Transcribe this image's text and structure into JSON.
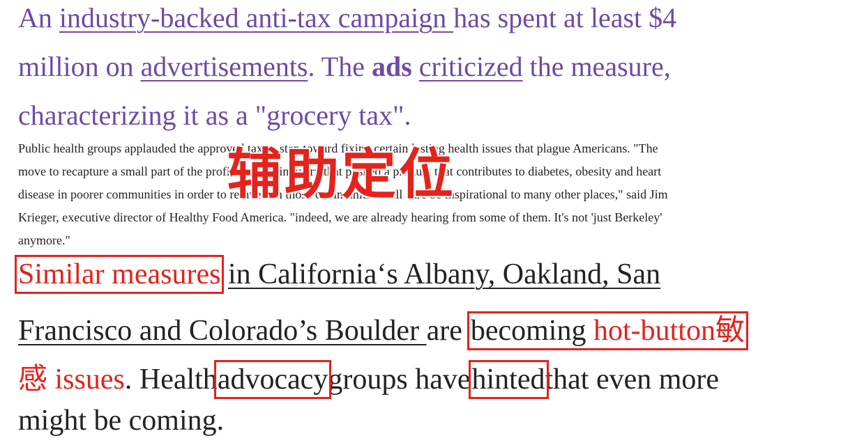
{
  "purple_para": {
    "l1_a": "An ",
    "l1_link": "industry-backed anti-tax campaign ",
    "l1_b": "has spent at least $4",
    "l2_a": "million on ",
    "l2_link": "advertisements",
    "l2_b": ". The ",
    "l2_bold": "ads",
    "l2_c": " ",
    "l2_link2": "criticized",
    "l2_d": " the measure,",
    "l3": "characterizing it as a \"grocery tax\"."
  },
  "quote_para": {
    "l1": "Public health groups applauded the approved tax as step toward fixing certain lasting health issues that plague Americans. \"The",
    "l2": "move to recapture a small part of the profit from an industry that pushed a product that contributes to diabetes, obesity and heart",
    "l3": "disease in poorer communities in order to reinvest in those communities will sure be inspirational to many other places,\" said Jim",
    "l4": "Krieger, executive director of Healthy Food America. \"indeed, we are already hearing from some of them. It's not 'just Berkeley'",
    "l5": "anymore.\""
  },
  "overlay_text": "辅助定位",
  "main_para": {
    "l1_box": "Similar measures",
    "l1_sp": " ",
    "l1_link": "in California‘s Albany, Oakland, San",
    "l2_link": "Francisco and Colorado’s Boulder ",
    "l2_a": "are",
    "l2_box_a": "becoming ",
    "l2_box_red": "hot-button敏",
    "l3_red": "感 issues",
    "l3_a": ". Health",
    "l3_box1": "advocacy",
    "l3_b": "groups have",
    "l3_box2": "hinted",
    "l3_c": "that even more",
    "l4": "might be coming."
  }
}
